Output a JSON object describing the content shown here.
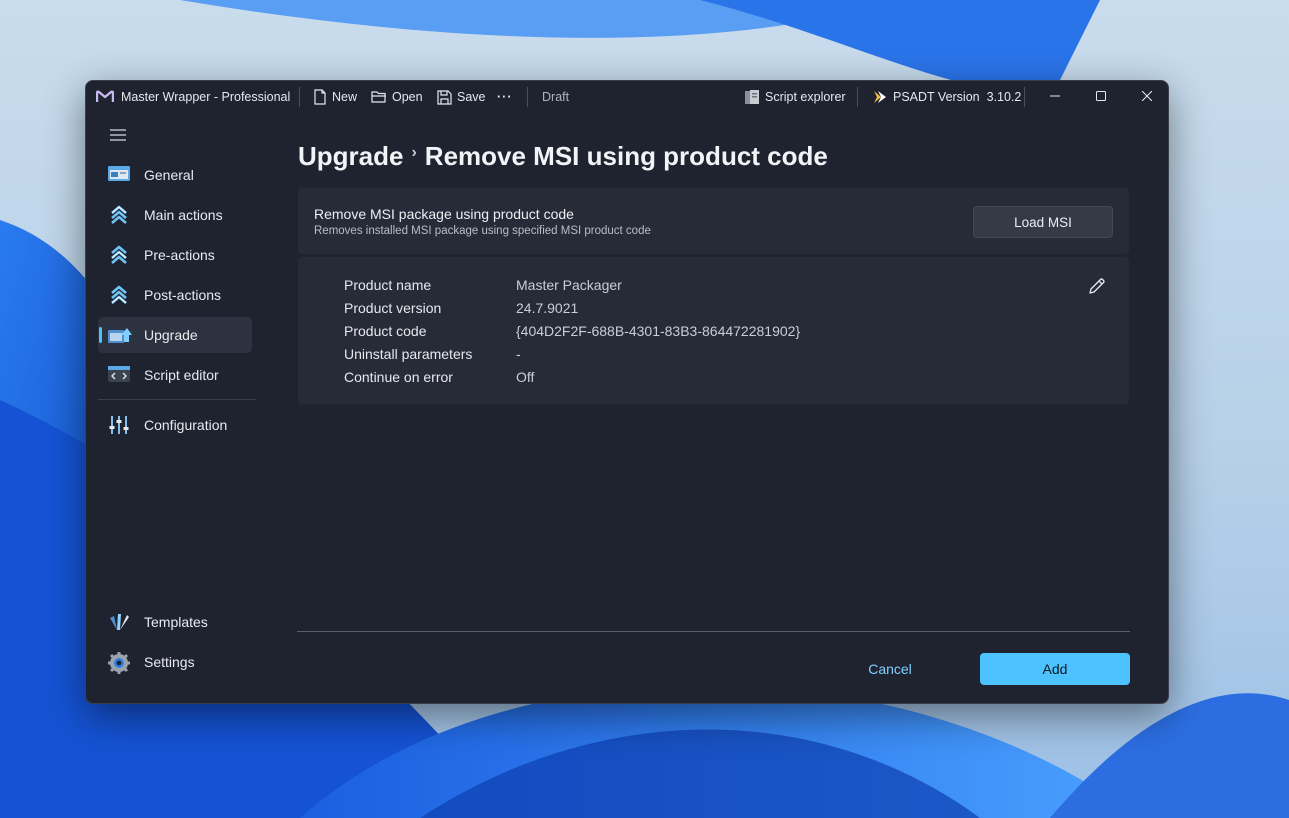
{
  "window": {
    "app_title": "Master Wrapper - Professional",
    "toolbar": {
      "new_label": "New",
      "open_label": "Open",
      "save_label": "Save",
      "more_label": "···",
      "status": "Draft",
      "script_explorer_label": "Script explorer",
      "psadt_label": "PSADT Version",
      "psadt_version": "3.10.2"
    }
  },
  "sidebar": {
    "items": [
      {
        "label": "General",
        "icon": "general-icon"
      },
      {
        "label": "Main actions",
        "icon": "main-actions-icon"
      },
      {
        "label": "Pre-actions",
        "icon": "pre-actions-icon"
      },
      {
        "label": "Post-actions",
        "icon": "post-actions-icon"
      },
      {
        "label": "Upgrade",
        "icon": "upgrade-icon",
        "selected": true
      },
      {
        "label": "Script editor",
        "icon": "script-editor-icon"
      }
    ],
    "configuration": {
      "label": "Configuration",
      "icon": "sliders-icon"
    },
    "bottom": [
      {
        "label": "Templates",
        "icon": "templates-icon"
      },
      {
        "label": "Settings",
        "icon": "gear-icon"
      }
    ]
  },
  "main": {
    "breadcrumb_parent": "Upgrade",
    "breadcrumb_separator": "›",
    "title": "Remove MSI using product code",
    "action_card": {
      "title": "Remove MSI package using product code",
      "subtitle": "Removes installed MSI package using specified MSI product code",
      "button_label": "Load MSI"
    },
    "properties": [
      {
        "key": "Product name",
        "value": "Master Packager"
      },
      {
        "key": "Product version",
        "value": "24.7.9021"
      },
      {
        "key": "Product code",
        "value": "{404D2F2F-688B-4301-83B3-864472281902}"
      },
      {
        "key": "Uninstall parameters",
        "value": "-"
      },
      {
        "key": "Continue on error",
        "value": "Off"
      }
    ],
    "cancel_label": "Cancel",
    "add_label": "Add"
  },
  "colors": {
    "accent": "#4cc2ff",
    "window_bg": "#1f2330",
    "card_bg": "#272b37"
  }
}
